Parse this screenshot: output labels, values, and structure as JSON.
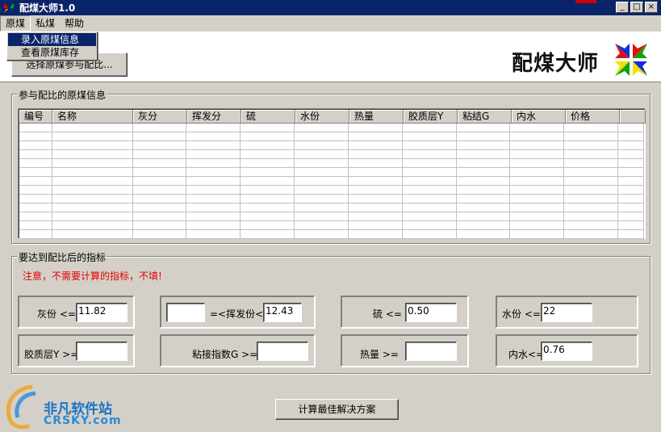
{
  "window": {
    "title": "配煤大师1.0",
    "buttons": [
      "_",
      "□",
      "×"
    ]
  },
  "menubar": {
    "items": [
      "原煤",
      "私煤",
      "帮助"
    ]
  },
  "dropdown": {
    "items": [
      "录入原煤信息",
      "查看原煤库存"
    ]
  },
  "header": {
    "select_button": "选择原煤参与配比...",
    "brand_title": "配煤大师"
  },
  "coal_group": {
    "title": "参与配比的原煤信息",
    "columns": [
      "编号",
      "名称",
      "灰分",
      "挥发分",
      "硫",
      "水份",
      "热量",
      "胶质层Y",
      "粘结G",
      "内水",
      "价格",
      ""
    ]
  },
  "target_group": {
    "title": "要达到配比后的指标",
    "warning": "注意，不需要计算的指标，不填!",
    "fields": {
      "ash": {
        "label": "灰份  <=",
        "value": "11.82"
      },
      "volatile_min": {
        "value": ""
      },
      "volatile": {
        "label": "=<挥发份<=",
        "value": "12.43"
      },
      "sulfur": {
        "label": "硫  <=",
        "value": "0.50"
      },
      "moisture": {
        "label": "水份  <=",
        "value": "22"
      },
      "colloid": {
        "label": "胶质层Y  >=",
        "value": ""
      },
      "caking": {
        "label": "粘接指数G  >=",
        "value": ""
      },
      "heat": {
        "label": "热量  >=",
        "value": ""
      },
      "inner_water": {
        "label": "内水<=",
        "value": "0.76"
      }
    }
  },
  "calc_button": "计算最佳解决方案",
  "watermark": {
    "title": "非凡软件站",
    "subtitle": "CRSKY.com"
  }
}
